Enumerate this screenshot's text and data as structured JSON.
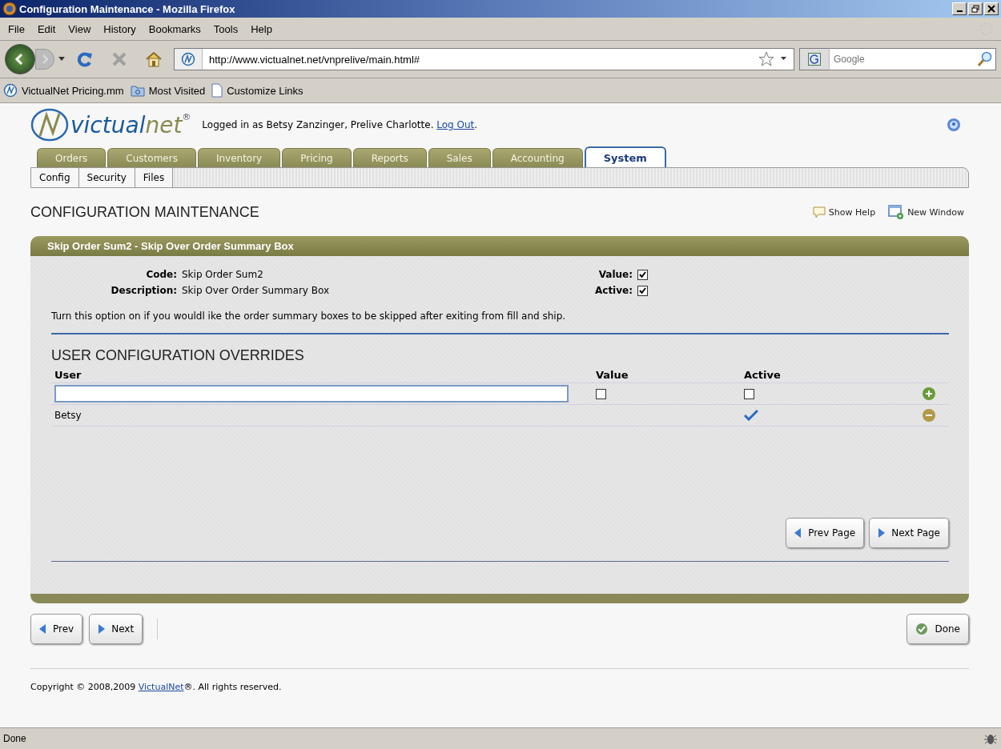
{
  "window": {
    "title": "Configuration Maintenance - Mozilla Firefox"
  },
  "menu": [
    "File",
    "Edit",
    "View",
    "History",
    "Bookmarks",
    "Tools",
    "Help"
  ],
  "address": {
    "url": "http://www.victualnet.net/vnprelive/main.html#"
  },
  "search": {
    "placeholder": "Google"
  },
  "bookmarks": [
    {
      "label": "VictualNet Pricing.mm",
      "kind": "site"
    },
    {
      "label": "Most Visited",
      "kind": "folder"
    },
    {
      "label": "Customize Links",
      "kind": "page"
    }
  ],
  "logo": {
    "first": "victual",
    "second": "net",
    "mark": "®"
  },
  "login": {
    "text": "Logged in as Betsy Zanzinger, Prelive Charlotte.",
    "link": "Log Out",
    "end": "."
  },
  "tabs": [
    {
      "label": "Orders",
      "selected": false
    },
    {
      "label": "Customers",
      "selected": false
    },
    {
      "label": "Inventory",
      "selected": false
    },
    {
      "label": "Pricing",
      "selected": false
    },
    {
      "label": "Reports",
      "selected": false
    },
    {
      "label": "Sales",
      "selected": false
    },
    {
      "label": "Accounting",
      "selected": false
    },
    {
      "label": "System",
      "selected": true
    }
  ],
  "subtabs": [
    "Config",
    "Security",
    "Files"
  ],
  "page_title": "CONFIGURATION MAINTENANCE",
  "actions": [
    {
      "label": "Show Help",
      "kind": "help"
    },
    {
      "label": "New Window",
      "kind": "window"
    }
  ],
  "panel": {
    "title": "Skip Order Sum2 - Skip Over Order Summary Box",
    "fields": [
      {
        "label": "Code:",
        "value": "Skip Order Sum2"
      },
      {
        "label": "Description:",
        "value": "Skip Over Order Summary Box"
      }
    ],
    "flags": [
      {
        "label": "Value:",
        "checked": true
      },
      {
        "label": "Active:",
        "checked": true
      }
    ],
    "note": "Turn this option on if you wouldl ike the order summary boxes to be skipped after exiting from fill and ship.",
    "overrides": {
      "heading": "USER CONFIGURATION OVERRIDES",
      "columns": [
        "User",
        "Value",
        "Active"
      ],
      "rows": [
        {
          "kind": "input",
          "value": false,
          "active": false
        },
        {
          "kind": "entry",
          "user": "Betsy",
          "value": false,
          "active": true
        }
      ]
    },
    "paging": [
      "Prev Page",
      "Next Page"
    ]
  },
  "nav_buttons": [
    "Prev",
    "Next"
  ],
  "done_button": "Done",
  "footer": {
    "text": "Copyright © 2008,2009 ",
    "link": "VictualNet",
    "end": "®. All rights reserved."
  },
  "status_bar": {
    "text": "Done"
  }
}
